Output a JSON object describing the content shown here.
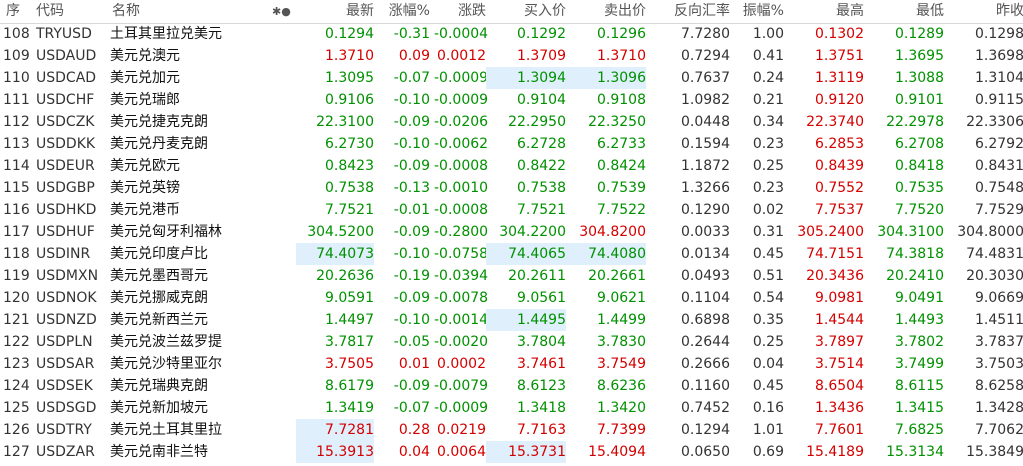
{
  "header": {
    "seq": "序",
    "code": "代码",
    "name": "名称",
    "marks": "✱●",
    "last": "最新",
    "pct": "涨幅%",
    "chg": "涨跌",
    "bid": "买入价",
    "ask": "卖出价",
    "inverse": "反向汇率",
    "amp": "振幅%",
    "high": "最高",
    "low": "最低",
    "prev": "昨收"
  },
  "colors": {
    "up": "#d40000",
    "down": "#009100",
    "neutral": "#333333",
    "highlight": "#dfeffb"
  },
  "rows": [
    {
      "seq": "108",
      "code": "TRYUSD",
      "name": "土耳其里拉兑美元",
      "last": "0.1294",
      "pct": "-0.31",
      "chg": "-0.0004",
      "bid": "0.1292",
      "ask": "0.1296",
      "inverse": "7.7280",
      "amp": "1.00",
      "high": "0.1302",
      "low": "0.1289",
      "prev": "0.1298"
    },
    {
      "seq": "109",
      "code": "USDAUD",
      "name": "美元兑澳元",
      "last": "1.3710",
      "pct": "0.09",
      "chg": "0.0012",
      "bid": "1.3709",
      "ask": "1.3710",
      "inverse": "0.7294",
      "amp": "0.41",
      "high": "1.3751",
      "low": "1.3695",
      "prev": "1.3698"
    },
    {
      "seq": "110",
      "code": "USDCAD",
      "name": "美元兑加元",
      "last": "1.3095",
      "pct": "-0.07",
      "chg": "-0.0009",
      "bid": "1.3094",
      "ask": "1.3096",
      "inverse": "0.7637",
      "amp": "0.24",
      "high": "1.3119",
      "low": "1.3088",
      "prev": "1.3104"
    },
    {
      "seq": "111",
      "code": "USDCHF",
      "name": "美元兑瑞郎",
      "last": "0.9106",
      "pct": "-0.10",
      "chg": "-0.0009",
      "bid": "0.9104",
      "ask": "0.9108",
      "inverse": "1.0982",
      "amp": "0.21",
      "high": "0.9120",
      "low": "0.9101",
      "prev": "0.9115"
    },
    {
      "seq": "112",
      "code": "USDCZK",
      "name": "美元兑捷克克朗",
      "last": "22.3100",
      "pct": "-0.09",
      "chg": "-0.0206",
      "bid": "22.2950",
      "ask": "22.3250",
      "inverse": "0.0448",
      "amp": "0.34",
      "high": "22.3740",
      "low": "22.2978",
      "prev": "22.3306"
    },
    {
      "seq": "113",
      "code": "USDDKK",
      "name": "美元兑丹麦克朗",
      "last": "6.2730",
      "pct": "-0.10",
      "chg": "-0.0062",
      "bid": "6.2728",
      "ask": "6.2733",
      "inverse": "0.1594",
      "amp": "0.23",
      "high": "6.2853",
      "low": "6.2708",
      "prev": "6.2792"
    },
    {
      "seq": "114",
      "code": "USDEUR",
      "name": "美元兑欧元",
      "last": "0.8423",
      "pct": "-0.09",
      "chg": "-0.0008",
      "bid": "0.8422",
      "ask": "0.8424",
      "inverse": "1.1872",
      "amp": "0.25",
      "high": "0.8439",
      "low": "0.8418",
      "prev": "0.8431"
    },
    {
      "seq": "115",
      "code": "USDGBP",
      "name": "美元兑英镑",
      "last": "0.7538",
      "pct": "-0.13",
      "chg": "-0.0010",
      "bid": "0.7538",
      "ask": "0.7539",
      "inverse": "1.3266",
      "amp": "0.23",
      "high": "0.7552",
      "low": "0.7535",
      "prev": "0.7548"
    },
    {
      "seq": "116",
      "code": "USDHKD",
      "name": "美元兑港币",
      "last": "7.7521",
      "pct": "-0.01",
      "chg": "-0.0008",
      "bid": "7.7521",
      "ask": "7.7522",
      "inverse": "0.1290",
      "amp": "0.02",
      "high": "7.7537",
      "low": "7.7520",
      "prev": "7.7529"
    },
    {
      "seq": "117",
      "code": "USDHUF",
      "name": "美元兑匈牙利福林",
      "last": "304.5200",
      "pct": "-0.09",
      "chg": "-0.2800",
      "bid": "304.2200",
      "ask": "304.8200",
      "inverse": "0.0033",
      "amp": "0.31",
      "high": "305.2400",
      "low": "304.3100",
      "prev": "304.8000"
    },
    {
      "seq": "118",
      "code": "USDINR",
      "name": "美元兑印度卢比",
      "last": "74.4073",
      "pct": "-0.10",
      "chg": "-0.0758",
      "bid": "74.4065",
      "ask": "74.4080",
      "inverse": "0.0134",
      "amp": "0.45",
      "high": "74.7151",
      "low": "74.3818",
      "prev": "74.4831"
    },
    {
      "seq": "119",
      "code": "USDMXN",
      "name": "美元兑墨西哥元",
      "last": "20.2636",
      "pct": "-0.19",
      "chg": "-0.0394",
      "bid": "20.2611",
      "ask": "20.2661",
      "inverse": "0.0493",
      "amp": "0.51",
      "high": "20.3436",
      "low": "20.2410",
      "prev": "20.3030"
    },
    {
      "seq": "120",
      "code": "USDNOK",
      "name": "美元兑挪威克朗",
      "last": "9.0591",
      "pct": "-0.09",
      "chg": "-0.0078",
      "bid": "9.0561",
      "ask": "9.0621",
      "inverse": "0.1104",
      "amp": "0.54",
      "high": "9.0981",
      "low": "9.0491",
      "prev": "9.0669"
    },
    {
      "seq": "121",
      "code": "USDNZD",
      "name": "美元兑新西兰元",
      "last": "1.4497",
      "pct": "-0.10",
      "chg": "-0.0014",
      "bid": "1.4495",
      "ask": "1.4499",
      "inverse": "0.6898",
      "amp": "0.35",
      "high": "1.4544",
      "low": "1.4493",
      "prev": "1.4511"
    },
    {
      "seq": "122",
      "code": "USDPLN",
      "name": "美元兑波兰兹罗提",
      "last": "3.7817",
      "pct": "-0.05",
      "chg": "-0.0020",
      "bid": "3.7804",
      "ask": "3.7830",
      "inverse": "0.2644",
      "amp": "0.25",
      "high": "3.7897",
      "low": "3.7802",
      "prev": "3.7837"
    },
    {
      "seq": "123",
      "code": "USDSAR",
      "name": "美元兑沙特里亚尔",
      "last": "3.7505",
      "pct": "0.01",
      "chg": "0.0002",
      "bid": "3.7461",
      "ask": "3.7549",
      "inverse": "0.2666",
      "amp": "0.04",
      "high": "3.7514",
      "low": "3.7499",
      "prev": "3.7503"
    },
    {
      "seq": "124",
      "code": "USDSEK",
      "name": "美元兑瑞典克朗",
      "last": "8.6179",
      "pct": "-0.09",
      "chg": "-0.0079",
      "bid": "8.6123",
      "ask": "8.6236",
      "inverse": "0.1160",
      "amp": "0.45",
      "high": "8.6504",
      "low": "8.6115",
      "prev": "8.6258"
    },
    {
      "seq": "125",
      "code": "USDSGD",
      "name": "美元兑新加坡元",
      "last": "1.3419",
      "pct": "-0.07",
      "chg": "-0.0009",
      "bid": "1.3418",
      "ask": "1.3420",
      "inverse": "0.7452",
      "amp": "0.16",
      "high": "1.3436",
      "low": "1.3415",
      "prev": "1.3428"
    },
    {
      "seq": "126",
      "code": "USDTRY",
      "name": "美元兑土耳其里拉",
      "last": "7.7281",
      "pct": "0.28",
      "chg": "0.0219",
      "bid": "7.7163",
      "ask": "7.7399",
      "inverse": "0.1294",
      "amp": "1.01",
      "high": "7.7601",
      "low": "7.6825",
      "prev": "7.7062"
    },
    {
      "seq": "127",
      "code": "USDZAR",
      "name": "美元兑南非兰特",
      "last": "15.3913",
      "pct": "0.04",
      "chg": "0.0064",
      "bid": "15.3731",
      "ask": "15.4094",
      "inverse": "0.0650",
      "amp": "0.69",
      "high": "15.4189",
      "low": "15.3134",
      "prev": "15.3849"
    }
  ]
}
